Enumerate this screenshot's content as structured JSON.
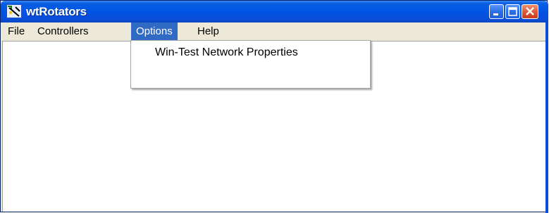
{
  "window": {
    "title": "wtRotators",
    "icon": "app-icon",
    "controls": [
      "minimize-icon",
      "maximize-icon",
      "close-icon"
    ]
  },
  "menubar": {
    "items": [
      {
        "label": "File"
      },
      {
        "label": "Controllers"
      },
      {
        "label": "Options",
        "active": true
      },
      {
        "label": "Help"
      }
    ]
  },
  "options_menu": {
    "items": [
      {
        "label": "Win-Test Network Properties"
      }
    ]
  },
  "colors": {
    "titlebar": "#0054e3",
    "menu_highlight": "#316ac5",
    "close_button": "#e05a3a"
  }
}
